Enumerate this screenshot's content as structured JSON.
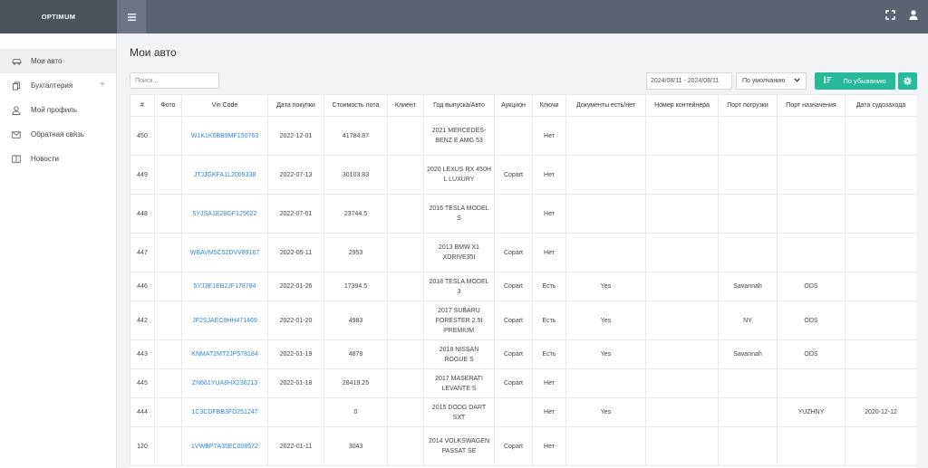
{
  "brand": "OPTIMUM",
  "icons": {
    "menu": "hamburger-icon",
    "fullscreen": "fullscreen-icon",
    "user": "user-icon",
    "sort": "sort-icon",
    "settings": "gear-icon"
  },
  "colors": {
    "accent": "#26b99a",
    "topbar": "#5a6370",
    "link": "#2f87d6"
  },
  "sidebar": {
    "items": [
      {
        "label": "Мои авто",
        "icon": "car-icon"
      },
      {
        "label": "Бухгалтерия",
        "icon": "book-icon"
      },
      {
        "label": "Мой профиль",
        "icon": "user-icon"
      },
      {
        "label": "Обратная связь",
        "icon": "mail-icon"
      },
      {
        "label": "Новости",
        "icon": "newspaper-icon"
      }
    ]
  },
  "page": {
    "title": "Мои авто"
  },
  "toolbar": {
    "search_placeholder": "Поиск...",
    "date_range": "2024/08/11 - 2024/08/11",
    "select_value": "По умолчанию",
    "sort_label": "По убыванию"
  },
  "table": {
    "headers": [
      "#",
      "Фото",
      "Vin Code",
      "Дата покупки",
      "Стоимость лота",
      "Клиент",
      "Год выпуска/Авто",
      "Аукцион",
      "Ключи",
      "Документы есть/нет",
      "Номер контейнера",
      "Порт погрузки",
      "Порт назначения",
      "Дата судозахода"
    ],
    "rows": [
      [
        "450",
        "",
        "W1K1K6BB9MF150763",
        "2022-12-01",
        "41784.87",
        "",
        "2021 MERCEDES-BENZ E AMG 53",
        "",
        "Нет",
        "",
        "",
        "",
        "",
        ""
      ],
      [
        "449",
        "",
        "JTJJGKFA1L2009338",
        "2022-07-13",
        "30103.83",
        "",
        "2020 LEXUS RX 450H L LUXURY",
        "Copart",
        "Нет",
        "",
        "",
        "",
        "",
        ""
      ],
      [
        "448",
        "",
        "5YJSA1E28GF125622",
        "2022-07-01",
        "23744.5",
        "",
        "2016 TESLA MODEL S",
        "",
        "Нет",
        "",
        "",
        "",
        "",
        ""
      ],
      [
        "447",
        "",
        "WBAVM5C52DVV89167",
        "2022-05-11",
        "2953",
        "",
        "2013 BMW X1 XDRIVE35I",
        "Copart",
        "Нет",
        "",
        "",
        "",
        "",
        ""
      ],
      [
        "446",
        "",
        "5YJ3E1EB2JF178784",
        "2022-01-26",
        "17394.5",
        "",
        "2018 TESLA MODEL 3",
        "Copart",
        "Есть",
        "Yes",
        "",
        "Savannah",
        "ODS",
        ""
      ],
      [
        "442",
        "",
        "JF2SJAEC8HH471469",
        "2022-01-20",
        "4983",
        "",
        "2017 SUBARU FORESTER 2.5I PREMIUM",
        "Copart",
        "Есть",
        "Yes",
        "",
        "NY",
        "ODS",
        ""
      ],
      [
        "443",
        "",
        "KNMAT2MT2JP578184",
        "2022-01-19",
        "4878",
        "",
        "2018 NISSAN ROGUE S",
        "Copart",
        "Есть",
        "Yes",
        "",
        "Savannah",
        "ODS",
        ""
      ],
      [
        "445",
        "",
        "ZN661YUA8HX236213",
        "2022-01-18",
        "28419.25",
        "",
        "2017 MASERATI LEVANTE S",
        "Copart",
        "Нет",
        "",
        "",
        "",
        "",
        ""
      ],
      [
        "444",
        "",
        "1C3CDFBB3FD251247",
        "",
        "0",
        "",
        "2015 DODG DART SXT",
        "",
        "Нет",
        "Yes",
        "",
        "",
        "YUZHNY",
        "2020-12-12"
      ],
      [
        "120",
        "",
        "1VWBP7A35EC008572",
        "2022-01-11",
        "3043",
        "",
        "2014 VOLKSWAGEN PASSAT SE",
        "Copart",
        "Нет",
        "",
        "",
        "",
        "",
        ""
      ]
    ]
  }
}
